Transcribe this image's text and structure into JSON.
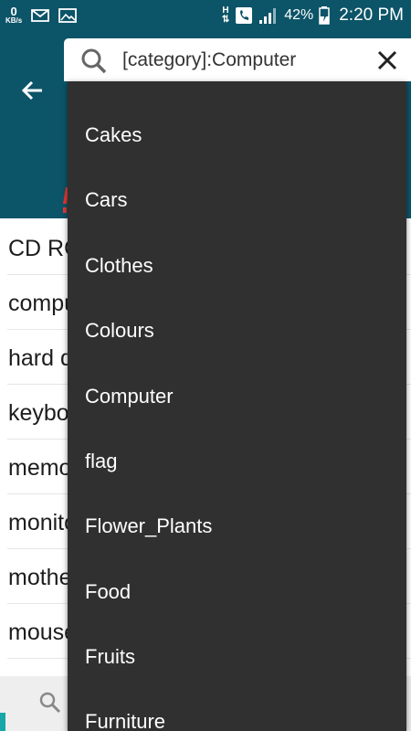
{
  "status_bar": {
    "speed_value": "0",
    "speed_unit": "KB/s",
    "network_type": "H",
    "battery": "42%",
    "time": "2:20 PM",
    "icons": [
      "mail-icon",
      "image-icon",
      "phone-icon",
      "signal-icon",
      "battery-icon"
    ]
  },
  "search": {
    "query": "[category]:Computer"
  },
  "background_list": [
    "CD ROM",
    "computer",
    "hard disk",
    "keyboard",
    "memory",
    "monitor",
    "motherboard",
    "mouse"
  ],
  "dropdown": {
    "items": [
      "Cakes",
      "Cars",
      "Clothes",
      "Colours",
      "Computer",
      "flag",
      "Flower_Plants",
      "Food",
      "Fruits",
      "Furniture"
    ]
  },
  "colors": {
    "primary": "#0c5468",
    "dropdown_bg": "#303030",
    "accent": "#18a6a6"
  }
}
